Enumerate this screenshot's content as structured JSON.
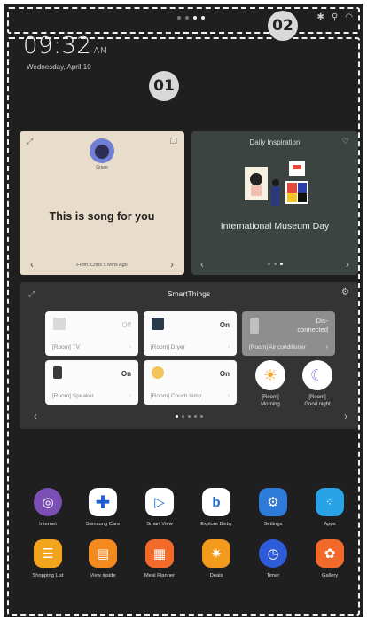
{
  "status_bar": {
    "page_dots": 4,
    "active_dot": 2,
    "icons": [
      "bluetooth-icon",
      "signal-icon",
      "wifi-icon"
    ]
  },
  "clock": {
    "time": "09:32",
    "ampm": "AM",
    "date": "Wednesday, April 10"
  },
  "callouts": {
    "main": "01",
    "status": "02"
  },
  "music_card": {
    "user": "Grace",
    "message": "This is song for you",
    "from": "From. Chris  5 Mins Ago"
  },
  "inspiration_card": {
    "title": "Daily Inspiration",
    "subtitle": "International Museum Day"
  },
  "smartthings": {
    "title": "SmartThings",
    "devices": [
      {
        "name": "[Room] TV",
        "state": "Off",
        "icon": "tv-icon"
      },
      {
        "name": "[Room] Dryer",
        "state": "On",
        "icon": "dryer-icon"
      },
      {
        "name": "[Room] Air conditioner",
        "state": "Dis-\nconnected",
        "icon": "air-conditioner-icon"
      },
      {
        "name": "[Room] Speaker",
        "state": "On",
        "icon": "speaker-icon"
      },
      {
        "name": "[Room] Couch lamp",
        "state": "On",
        "icon": "lamp-icon"
      }
    ],
    "scenes": [
      {
        "name": "[Room]\nMorning",
        "icon": "sun-icon"
      },
      {
        "name": "[Room]\nGood night",
        "icon": "moon-icon"
      }
    ]
  },
  "apps": [
    {
      "label": "Internet",
      "icon": "internet-icon",
      "color": "#7b4fb4"
    },
    {
      "label": "Samsung Care",
      "icon": "samsung-care-icon",
      "color": "#ffffff"
    },
    {
      "label": "Smart View",
      "icon": "smart-view-icon",
      "color": "#ffffff"
    },
    {
      "label": "Explore Bixby",
      "icon": "bixby-icon",
      "color": "#ffffff"
    },
    {
      "label": "Settings",
      "icon": "settings-icon",
      "color": "#2e7ad8"
    },
    {
      "label": "Apps",
      "icon": "apps-icon",
      "color": "#2aa3e6"
    },
    {
      "label": "Shopping List",
      "icon": "shopping-list-icon",
      "color": "#f2a51c"
    },
    {
      "label": "View inside",
      "icon": "view-inside-icon",
      "color": "#f28a1e"
    },
    {
      "label": "Meal Planner",
      "icon": "meal-planner-icon",
      "color": "#f26b2a"
    },
    {
      "label": "Deals",
      "icon": "deals-icon",
      "color": "#f29a1c"
    },
    {
      "label": "Timer",
      "icon": "timer-icon",
      "color": "#2e5bd8"
    },
    {
      "label": "Gallery",
      "icon": "gallery-icon",
      "color": "#f26a2a"
    }
  ]
}
